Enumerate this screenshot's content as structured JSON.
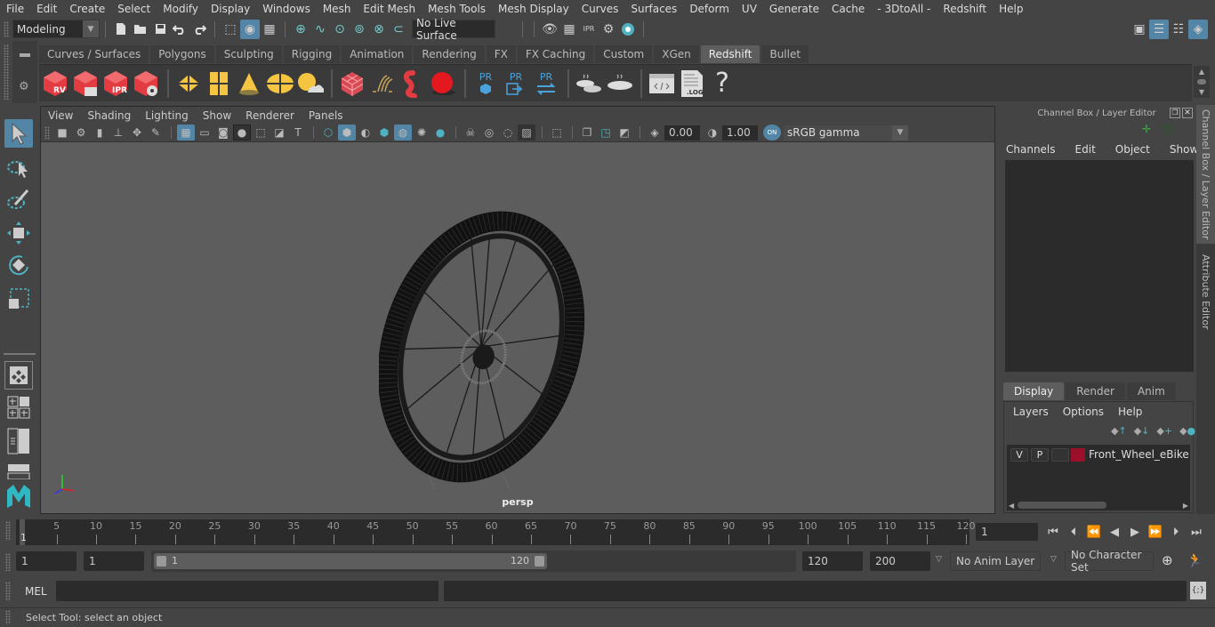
{
  "menubar": {
    "items": [
      "File",
      "Edit",
      "Create",
      "Select",
      "Modify",
      "Display",
      "Windows",
      "Mesh",
      "Edit Mesh",
      "Mesh Tools",
      "Mesh Display",
      "Curves",
      "Surfaces",
      "Deform",
      "UV",
      "Generate",
      "Cache",
      "- 3DtoAll -",
      "Redshift",
      "Help"
    ]
  },
  "statusline": {
    "workspace": "Modeling",
    "live_surface": "No Live Surface",
    "icons": [
      "new-scene-icon",
      "open-scene-icon",
      "save-scene-icon",
      "undo-icon",
      "redo-icon",
      "select-hierarchy-icon",
      "select-object-icon",
      "select-component-icon",
      "snap-grid-icon",
      "snap-curve-icon",
      "snap-point-icon",
      "snap-view-plane-icon",
      "snap-surface-icon",
      "make-live-icon",
      "render-view-icon",
      "render-icon",
      "ipr-render-icon",
      "render-settings-icon",
      "hypershade-icon"
    ]
  },
  "right_icons": [
    "modeling-toolkit-icon",
    "channel-box-toggle-icon",
    "attribute-editor-toggle-icon",
    "tool-settings-toggle-icon"
  ],
  "shelf": {
    "tabs": [
      "Curves / Surfaces",
      "Polygons",
      "Sculpting",
      "Rigging",
      "Animation",
      "Rendering",
      "FX",
      "FX Caching",
      "Custom",
      "XGen",
      "Redshift",
      "Bullet"
    ],
    "active_tab": "Redshift",
    "icon_labels": {
      "rv": "RV",
      "ipr": "IPR",
      "pr": "PR",
      "log": ".LOG",
      "help": "?"
    }
  },
  "viewport": {
    "menu": [
      "View",
      "Shading",
      "Lighting",
      "Show",
      "Renderer",
      "Panels"
    ],
    "exposure": "0.00",
    "gamma": "1.00",
    "color_space": "sRGB gamma",
    "color_mgmt_label": "ON",
    "camera": "persp",
    "object_name": "Front_Wheel_eBike"
  },
  "channel_box": {
    "title": "Channel Box / Layer Editor",
    "menu": [
      "Channels",
      "Edit",
      "Object",
      "Show"
    ]
  },
  "layer_editor": {
    "tabs": [
      "Display",
      "Render",
      "Anim"
    ],
    "active_tab": "Display",
    "menu": [
      "Layers",
      "Options",
      "Help"
    ],
    "layers": [
      {
        "visible": "V",
        "playback": "P",
        "type": "",
        "color": "#9b0f2b",
        "name": "Front_Wheel_eBike"
      }
    ]
  },
  "side_tabs": [
    "Channel Box / Layer Editor",
    "Attribute Editor"
  ],
  "timeline": {
    "ticks": [
      5,
      10,
      15,
      20,
      25,
      30,
      35,
      40,
      45,
      50,
      55,
      60,
      65,
      70,
      75,
      80,
      85,
      90,
      95,
      100,
      105,
      110,
      115,
      120
    ],
    "start_label": "1",
    "current_frame": "1",
    "range_min": 1,
    "range_max": 120
  },
  "range": {
    "start_time": "1",
    "playback_start": "1",
    "slider_start": "1",
    "slider_end": "120",
    "playback_end": "120",
    "end_time": "200",
    "anim_layer": "No Anim Layer",
    "character_set": "No Character Set"
  },
  "command_line": {
    "language": "MEL",
    "input": "",
    "result": ""
  },
  "help_line": "Select Tool: select an object"
}
